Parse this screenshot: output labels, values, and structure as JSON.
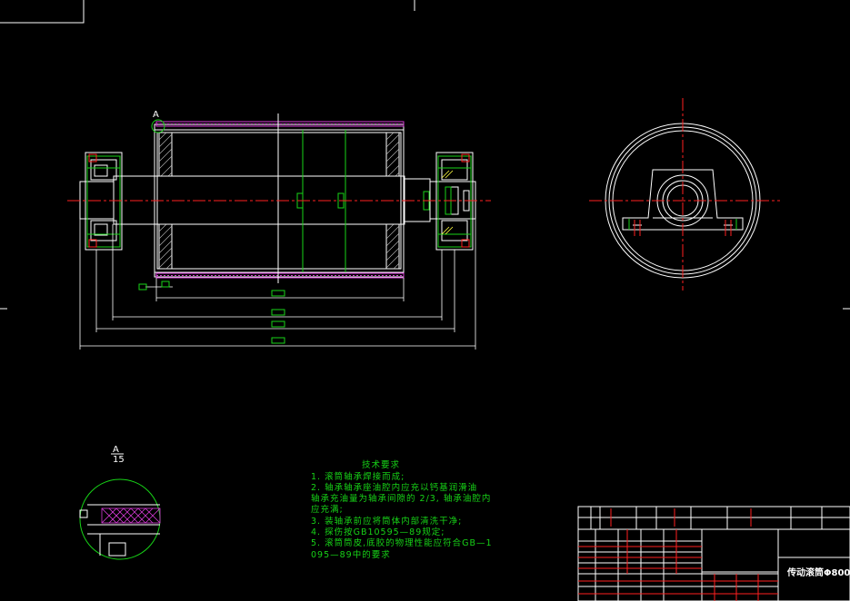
{
  "drawing": {
    "view_label_a": "A",
    "detail_label_a": "A",
    "detail_scale": "15",
    "title_block_name": "传动滚筒Φ800",
    "colors": {
      "background": "#000000",
      "outline": "#ffffff",
      "centerline": "#ff2020",
      "dimension": "#17d317",
      "hatch": "#d83cd8",
      "section": "#ffff40"
    }
  },
  "tech_requirements": {
    "title": "技术要求",
    "lines": [
      "1. 滚筒轴承焊接而成;",
      "2. 轴承轴承座油腔内应充以钙基润滑油",
      "轴承充油量为轴承间隙的 2/3, 轴承油腔内",
      "应充满;",
      "3. 装轴承前应将筒体内部清洗干净;",
      "4. 探伤按GB10595—89规定;",
      "5. 滚筒筒皮,底胶的物理性能应符合GB—1",
      "095—89中的要求"
    ]
  }
}
